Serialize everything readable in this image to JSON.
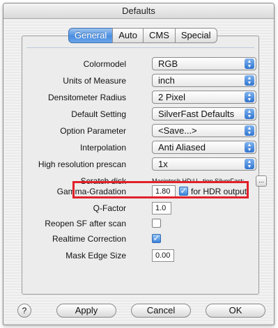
{
  "window": {
    "title": "Defaults"
  },
  "tabs": [
    {
      "label": "General",
      "active": true
    },
    {
      "label": "Auto",
      "active": false
    },
    {
      "label": "CMS",
      "active": false
    },
    {
      "label": "Special",
      "active": false
    }
  ],
  "settings": {
    "colormodel": {
      "label": "Colormodel",
      "value": "RGB"
    },
    "units": {
      "label": "Units of Measure",
      "value": "inch"
    },
    "densitometer": {
      "label": "Densitometer Radius",
      "value": "2 Pixel"
    },
    "default_setting": {
      "label": "Default Setting",
      "value": "SilverFast Defaults"
    },
    "option_parameter": {
      "label": "Option Parameter",
      "value": "<Save...>"
    },
    "interpolation": {
      "label": "Interpolation",
      "value": "Anti Aliased"
    },
    "prescan": {
      "label": "High resolution prescan",
      "value": "1x"
    },
    "scratch_disk": {
      "label": "Scratch disk",
      "value": "Macintosh HD:U...tion SilverFast:",
      "button": "..."
    },
    "gamma": {
      "label": "Gamma-Gradation",
      "value": "1.80",
      "hdr_label": "for HDR output",
      "hdr_checked": true
    },
    "qfactor": {
      "label": "Q-Factor",
      "value": "1.0"
    },
    "reopen": {
      "label": "Reopen SF after scan",
      "checked": false
    },
    "realtime": {
      "label": "Realtime Correction",
      "checked": true
    },
    "mask_edge": {
      "label": "Mask Edge Size",
      "value": "0.00"
    }
  },
  "buttons": {
    "help": "?",
    "apply": "Apply",
    "cancel": "Cancel",
    "ok": "OK"
  },
  "colors": {
    "highlight": "#e1202a",
    "accent": "#4a8ee0"
  }
}
